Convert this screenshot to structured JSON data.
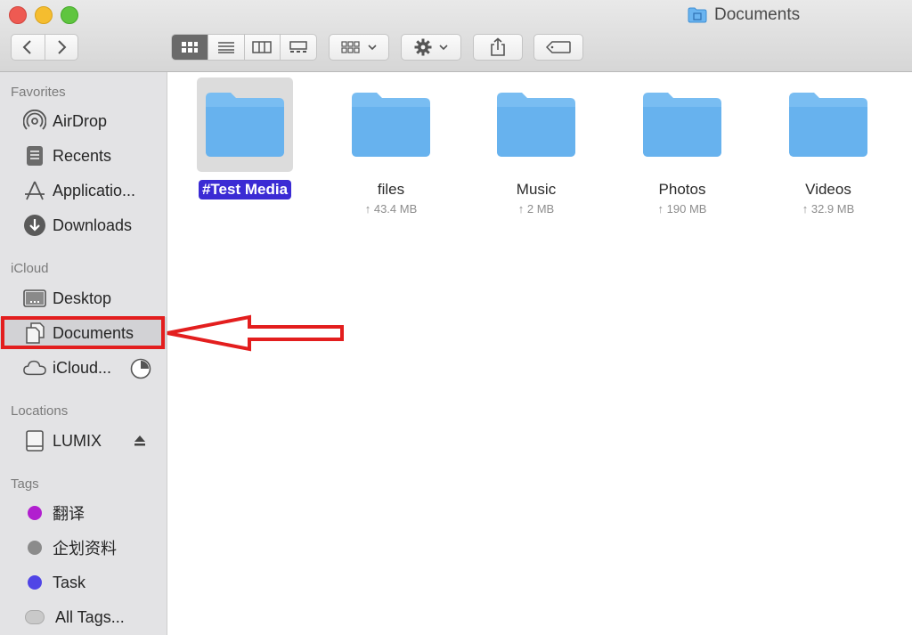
{
  "window": {
    "title": "Documents"
  },
  "sidebar": {
    "sections": {
      "favorites": "Favorites",
      "icloud": "iCloud",
      "locations": "Locations",
      "tags": "Tags"
    },
    "favorites": [
      {
        "label": "AirDrop",
        "icon": "airdrop-icon"
      },
      {
        "label": "Recents",
        "icon": "recents-icon"
      },
      {
        "label": "Applicatio...",
        "icon": "applications-icon"
      },
      {
        "label": "Downloads",
        "icon": "downloads-icon"
      }
    ],
    "icloud": [
      {
        "label": "Desktop",
        "icon": "desktop-icon"
      },
      {
        "label": "Documents",
        "icon": "documents-icon",
        "selected": true
      },
      {
        "label": "iCloud...",
        "icon": "icloud-icon"
      }
    ],
    "locations": [
      {
        "label": "LUMIX",
        "icon": "drive-icon"
      }
    ],
    "tags": [
      {
        "label": "翻译",
        "color": "#b11fcf"
      },
      {
        "label": "企划资料",
        "color": "#8b8b8b"
      },
      {
        "label": "Task",
        "color": "#5045e6"
      },
      {
        "label": "All Tags...",
        "color": "#c9c9c9"
      }
    ]
  },
  "files": [
    {
      "name": "#Test Media",
      "size": "",
      "selected": true
    },
    {
      "name": "files",
      "size": "↑ 43.4 MB"
    },
    {
      "name": "Music",
      "size": "↑ 2 MB"
    },
    {
      "name": "Photos",
      "size": "↑ 190 MB"
    },
    {
      "name": "Videos",
      "size": "↑ 32.9 MB"
    }
  ],
  "colors": {
    "folder": "#6ab4f0",
    "selection": "#3b2bd4",
    "annotation": "#e31e1e"
  }
}
